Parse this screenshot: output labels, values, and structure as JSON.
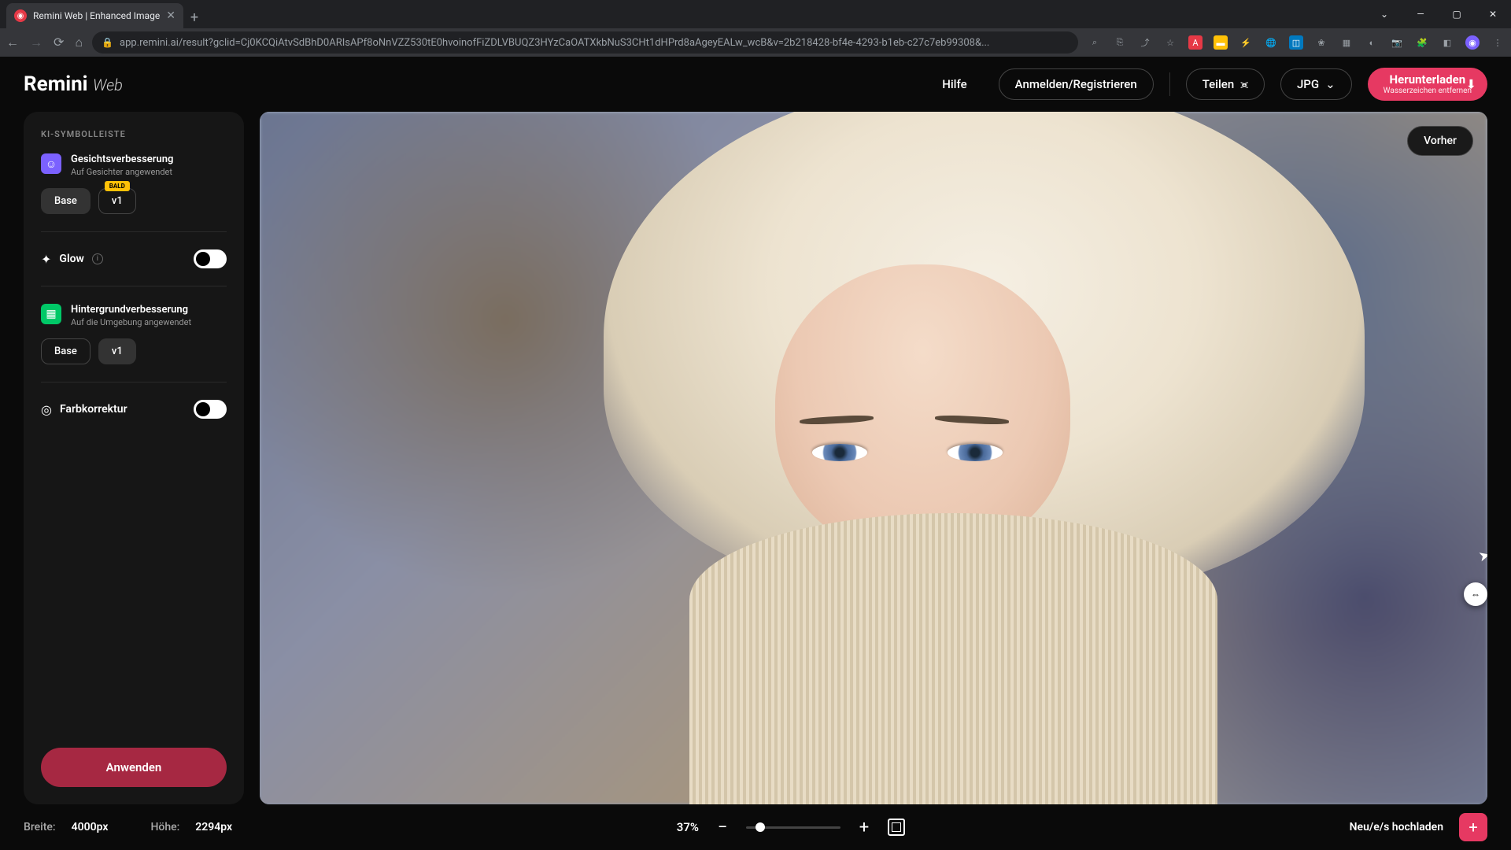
{
  "browser": {
    "tab_title": "Remini Web | Enhanced Image",
    "url": "app.remini.ai/result?gclid=Cj0KCQiAtvSdBhD0ARIsAPf8oNnVZZ530tE0hvoinofFiZDLVBUQZ3HYzCaOATXkbNuS3CHt1dHPrd8aAgeyEALw_wcB&v=2b218428-bf4e-4293-b1eb-c27c7eb99308&..."
  },
  "header": {
    "logo_main": "Remini",
    "logo_sub": "Web",
    "help": "Hilfe",
    "login": "Anmelden/Registrieren",
    "share": "Teilen",
    "format": "JPG",
    "download": "Herunterladen",
    "download_sub": "Wasserzeichen entfernen"
  },
  "sidebar": {
    "section_label": "KI-SYMBOLLEISTE",
    "face": {
      "title": "Gesichtsverbesserung",
      "subtitle": "Auf Gesichter angewendet",
      "opt_base": "Base",
      "opt_v1": "v1",
      "badge": "BALD"
    },
    "glow": {
      "label": "Glow"
    },
    "bg": {
      "title": "Hintergrundverbesserung",
      "subtitle": "Auf die Umgebung angewendet",
      "opt_base": "Base",
      "opt_v1": "v1"
    },
    "color": {
      "label": "Farbkorrektur"
    },
    "apply": "Anwenden"
  },
  "canvas": {
    "before": "Vorher"
  },
  "bottom": {
    "width_label": "Breite:",
    "width_val": "4000px",
    "height_label": "Höhe:",
    "height_val": "2294px",
    "zoom": "37%",
    "upload": "Neu/e/s hochladen"
  }
}
